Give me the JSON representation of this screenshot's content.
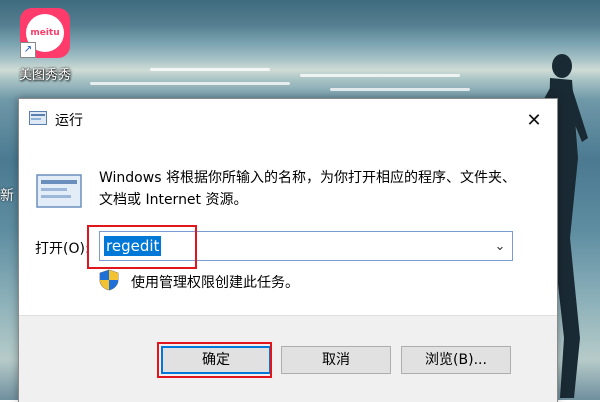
{
  "desktop": {
    "icon_label": "美图秀秀",
    "logo_text": "meitu",
    "edge_glyph": "新"
  },
  "dialog": {
    "title": "运行",
    "description": "Windows 将根据你所输入的名称，为你打开相应的程序、文件夹、文档或 Internet 资源。",
    "open_label": "打开(O):",
    "open_value": "regedit",
    "admin_note": "使用管理权限创建此任务。",
    "buttons": {
      "ok": "确定",
      "cancel": "取消",
      "browse": "浏览(B)..."
    }
  },
  "icons": [
    "run-icon",
    "close-icon",
    "shield-icon",
    "chevron-down-icon",
    "shortcut-arrow-icon"
  ],
  "colors": {
    "accent": "#0078d7",
    "highlight_box": "#e0161c",
    "meitu_brand": "#fe3b6a"
  }
}
